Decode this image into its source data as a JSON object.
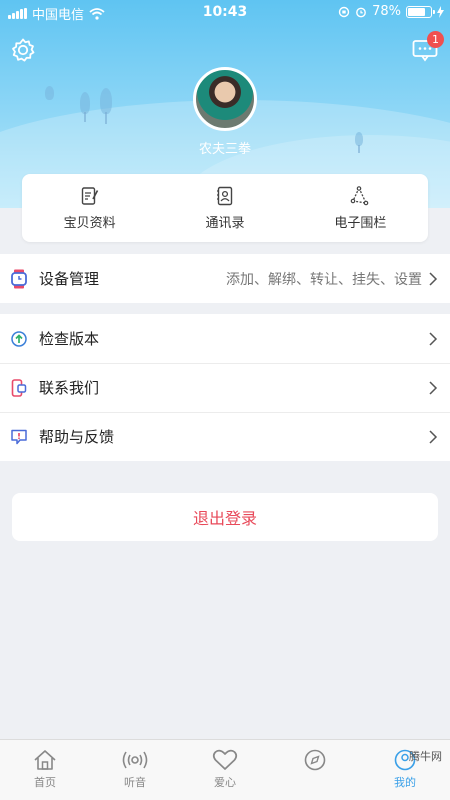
{
  "status_bar": {
    "carrier": "中国电信",
    "time": "10:43",
    "battery": "78%",
    "battery_level": 0.78
  },
  "header": {
    "nickname": "农夫三拳",
    "message_badge": "1"
  },
  "quick_actions": [
    {
      "label": "宝贝资料",
      "icon": "profile-doc-icon"
    },
    {
      "label": "通讯录",
      "icon": "contacts-icon"
    },
    {
      "label": "电子围栏",
      "icon": "geofence-icon"
    }
  ],
  "device": {
    "label": "设备管理",
    "detail": "添加、解绑、转让、挂失、设置",
    "icon": "watch-icon"
  },
  "menu": [
    {
      "label": "检查版本",
      "icon": "upgrade-icon"
    },
    {
      "label": "联系我们",
      "icon": "phone-contact-icon"
    },
    {
      "label": "帮助与反馈",
      "icon": "feedback-icon"
    }
  ],
  "logout_label": "退出登录",
  "tabs": [
    {
      "label": "首页",
      "icon": "home-icon",
      "active": false
    },
    {
      "label": "听音",
      "icon": "listen-icon",
      "active": false
    },
    {
      "label": "爱心",
      "icon": "heart-icon",
      "active": false
    },
    {
      "label": "",
      "icon": "compass-icon",
      "active": false
    },
    {
      "label": "我的",
      "icon": "profile-icon",
      "active": true
    }
  ],
  "watermark": "腾牛网",
  "colors": {
    "accent": "#3aa0e8",
    "logout_red": "#e84a5a",
    "header_blue": "#5fc4f2",
    "badge_red": "#f05050"
  }
}
